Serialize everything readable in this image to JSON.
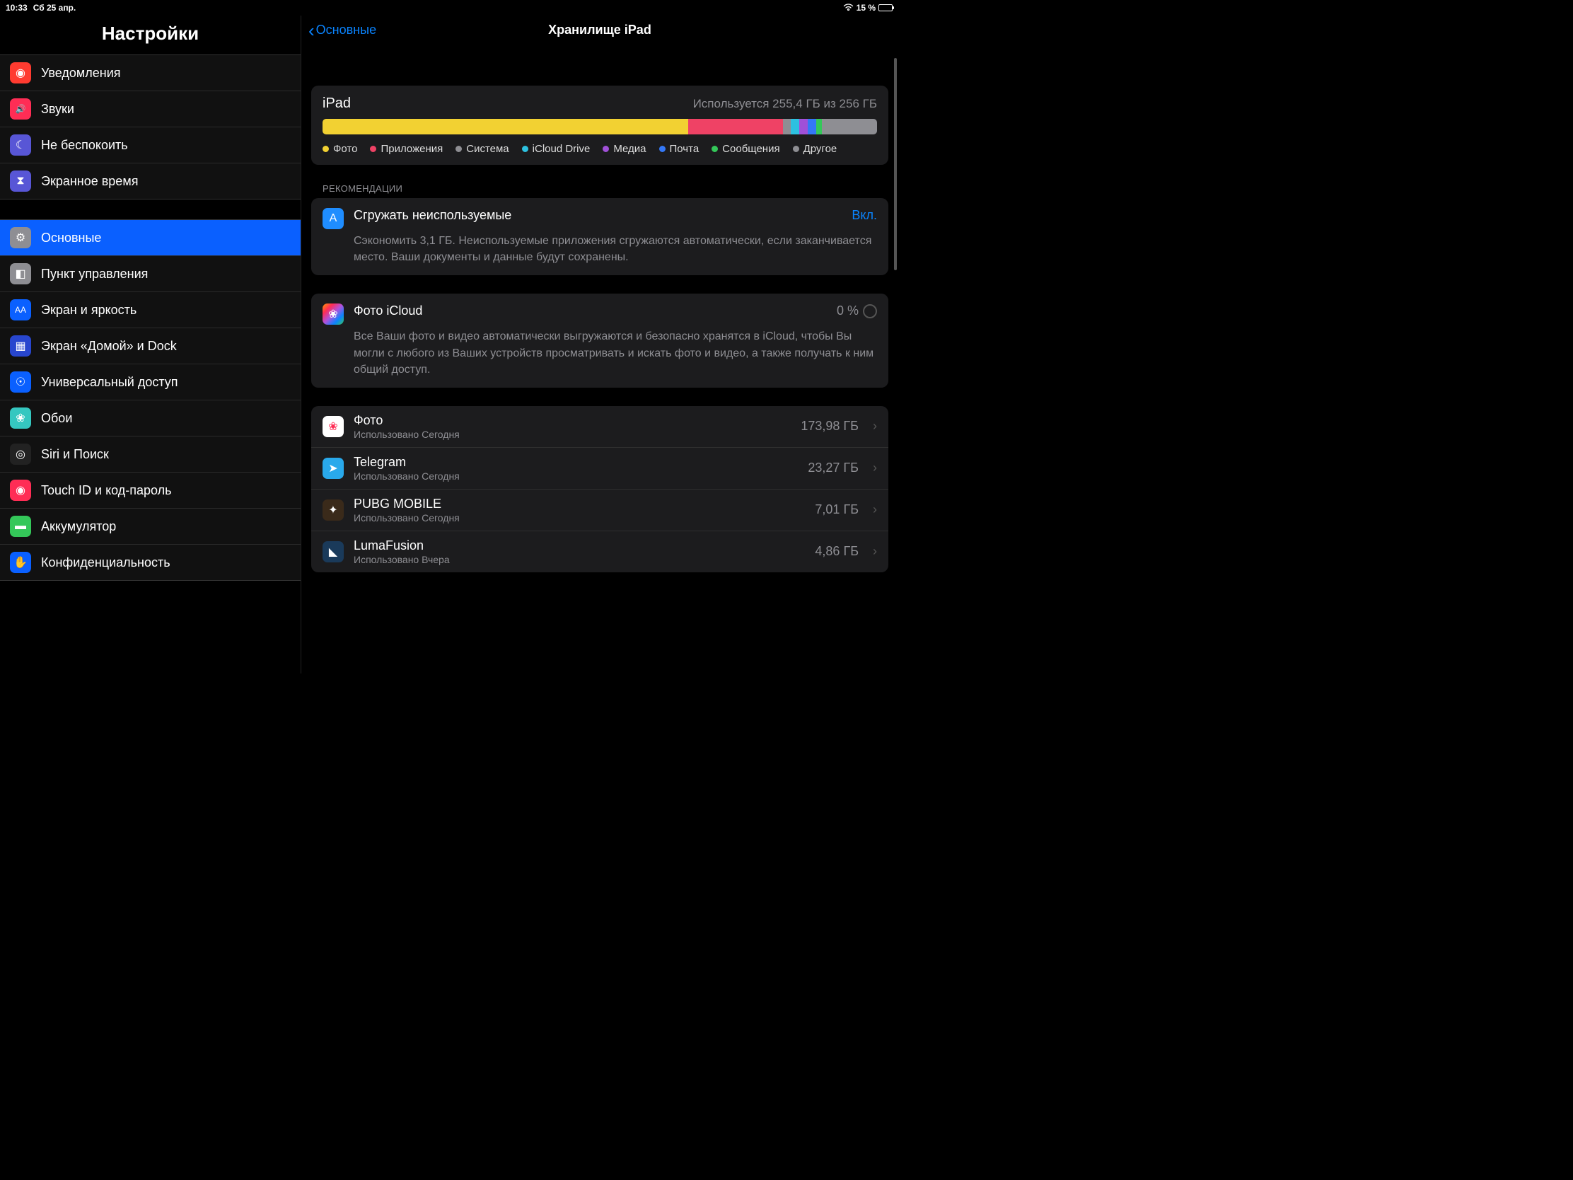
{
  "status": {
    "time": "10:33",
    "date": "Сб 25 апр.",
    "battery": "15 %"
  },
  "sidebar": {
    "title": "Настройки",
    "groups": [
      {
        "items": [
          {
            "id": "notifications",
            "label": "Уведомления",
            "icon_bg": "#ff3b30",
            "glyph": "◉"
          },
          {
            "id": "sounds",
            "label": "Звуки",
            "icon_bg": "#ff2d55",
            "glyph": "🔊"
          },
          {
            "id": "dnd",
            "label": "Не беспокоить",
            "icon_bg": "#5856d6",
            "glyph": "☾"
          },
          {
            "id": "screentime",
            "label": "Экранное время",
            "icon_bg": "#5856d6",
            "glyph": "⧗"
          }
        ]
      },
      {
        "items": [
          {
            "id": "general",
            "label": "Основные",
            "icon_bg": "#8e8e93",
            "glyph": "⚙",
            "selected": true
          },
          {
            "id": "control-center",
            "label": "Пункт управления",
            "icon_bg": "#8e8e93",
            "glyph": "◧"
          },
          {
            "id": "display",
            "label": "Экран и яркость",
            "icon_bg": "#0a60ff",
            "glyph": "AA"
          },
          {
            "id": "home",
            "label": "Экран «Домой» и Dock",
            "icon_bg": "#2846ce",
            "glyph": "▦"
          },
          {
            "id": "accessibility",
            "label": "Универсальный доступ",
            "icon_bg": "#0a60ff",
            "glyph": "☉"
          },
          {
            "id": "wallpaper",
            "label": "Обои",
            "icon_bg": "#35c7c0",
            "glyph": "❀"
          },
          {
            "id": "siri",
            "label": "Siri и Поиск",
            "icon_bg": "#222",
            "glyph": "◎"
          },
          {
            "id": "touchid",
            "label": "Touch ID и код-пароль",
            "icon_bg": "#ff2d55",
            "glyph": "◉"
          },
          {
            "id": "battery",
            "label": "Аккумулятор",
            "icon_bg": "#34c759",
            "glyph": "▬"
          },
          {
            "id": "privacy",
            "label": "Конфиденциальность",
            "icon_bg": "#0a60ff",
            "glyph": "✋"
          }
        ]
      }
    ]
  },
  "main": {
    "back": "Основные",
    "title": "Хранилище iPad",
    "storage_card": {
      "name": "iPad",
      "used_text": "Используется 255,4 ГБ из 256 ГБ",
      "segments": [
        {
          "label": "Фото",
          "color": "#f2d132",
          "pct": 66
        },
        {
          "label": "Приложения",
          "color": "#ef4265",
          "pct": 17
        },
        {
          "label": "Система",
          "color": "#8e8e93",
          "pct": 1.5
        },
        {
          "label": "iCloud Drive",
          "color": "#2dc1e0",
          "pct": 1.5
        },
        {
          "label": "Медиа",
          "color": "#a050d8",
          "pct": 1.5
        },
        {
          "label": "Почта",
          "color": "#3478f6",
          "pct": 1.5
        },
        {
          "label": "Сообщения",
          "color": "#34c759",
          "pct": 1
        },
        {
          "label": "Другое",
          "color": "#8e8e93",
          "pct": 10
        }
      ]
    },
    "recommendations": {
      "header": "РЕКОМЕНДАЦИИ",
      "items": [
        {
          "id": "offload",
          "title": "Сгружать неиспользуемые",
          "status": "Вкл.",
          "desc": "Сэкономить 3,1 ГБ. Неиспользуемые приложения сгружаются автоматически, если заканчивается место. Ваши документы и данные будут сохранены.",
          "icon_bg": "#1f8dff",
          "glyph": "A"
        },
        {
          "id": "icloud-photo",
          "title": "Фото iCloud",
          "status": "0 %",
          "desc": "Все Ваши фото и видео автоматически выгружаются и безопасно хранятся в iCloud, чтобы Вы могли с любого из Ваших устройств просматривать и искать фото и видео, а также получать к ним общий доступ.",
          "icon_bg": "linear-gradient(135deg,#ff9a00,#ff2d55,#af52de,#0a84ff,#34c759)",
          "glyph": "❀",
          "progress": true
        }
      ]
    },
    "apps": [
      {
        "name": "Фото",
        "sub": "Использовано Сегодня",
        "size": "173,98 ГБ",
        "icon_bg": "#fff",
        "glyph": "❀"
      },
      {
        "name": "Telegram",
        "sub": "Использовано Сегодня",
        "size": "23,27 ГБ",
        "icon_bg": "#29a9eb",
        "glyph": "➤"
      },
      {
        "name": "PUBG MOBILE",
        "sub": "Использовано Сегодня",
        "size": "7,01 ГБ",
        "icon_bg": "#3a2a1a",
        "glyph": "✦"
      },
      {
        "name": "LumaFusion",
        "sub": "Использовано Вчера",
        "size": "4,86 ГБ",
        "icon_bg": "#1a3a5a",
        "glyph": "◣"
      }
    ]
  }
}
